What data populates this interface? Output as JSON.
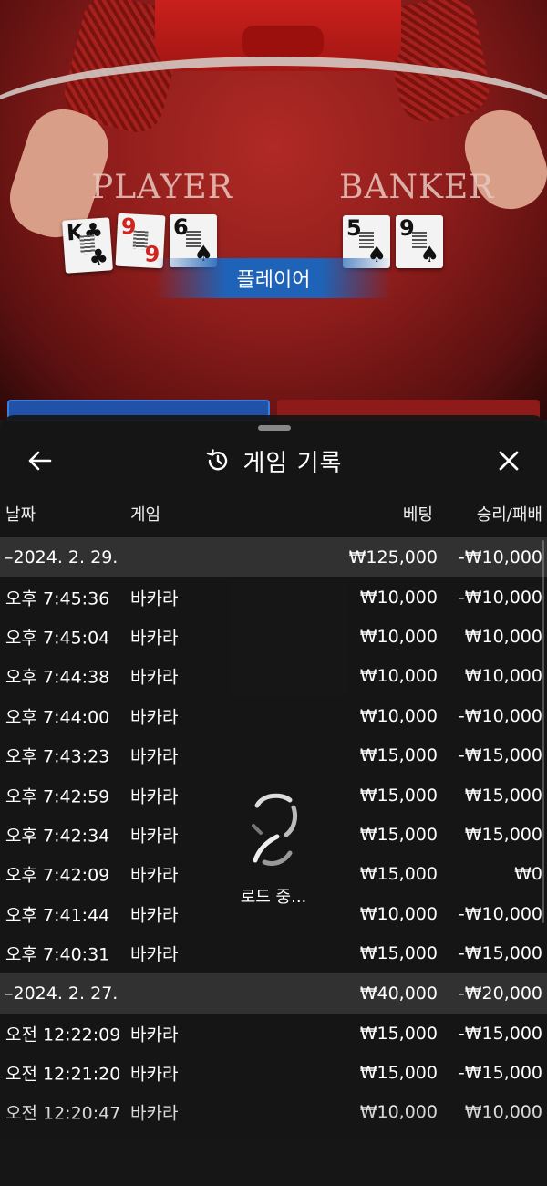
{
  "video": {
    "player_label": "PLAYER",
    "banker_label": "BANKER",
    "result_banner": "플레이어",
    "player_cards": [
      {
        "rank": "K",
        "suit": "♣",
        "color": "black"
      },
      {
        "rank": "9",
        "suit": "♦",
        "color": "red"
      },
      {
        "rank": "6",
        "suit": "♠",
        "color": "black"
      }
    ],
    "banker_cards": [
      {
        "rank": "5",
        "suit": "♠",
        "color": "black"
      },
      {
        "rank": "9",
        "suit": "♠",
        "color": "black"
      }
    ]
  },
  "sheet": {
    "title": "게임 기록",
    "back_icon": "arrow-left-icon",
    "history_icon": "history-icon",
    "close_icon": "close-icon",
    "columns": {
      "date": "날짜",
      "game": "게임",
      "bet": "베팅",
      "win_loss": "승리/패배"
    },
    "groups": [
      {
        "date": "–2024. 2. 29.",
        "bet_total": "₩125,000",
        "win_total": "-₩10,000",
        "rows": [
          {
            "time": "오후 7:45:36",
            "game": "바카라",
            "bet": "₩10,000",
            "win": "-₩10,000"
          },
          {
            "time": "오후 7:45:04",
            "game": "바카라",
            "bet": "₩10,000",
            "win": "₩10,000"
          },
          {
            "time": "오후 7:44:38",
            "game": "바카라",
            "bet": "₩10,000",
            "win": "₩10,000"
          },
          {
            "time": "오후 7:44:00",
            "game": "바카라",
            "bet": "₩10,000",
            "win": "-₩10,000"
          },
          {
            "time": "오후 7:43:23",
            "game": "바카라",
            "bet": "₩15,000",
            "win": "-₩15,000"
          },
          {
            "time": "오후 7:42:59",
            "game": "바카라",
            "bet": "₩15,000",
            "win": "₩15,000"
          },
          {
            "time": "오후 7:42:34",
            "game": "바카라",
            "bet": "₩15,000",
            "win": "₩15,000"
          },
          {
            "time": "오후 7:42:09",
            "game": "바카라",
            "bet": "₩15,000",
            "win": "₩0"
          },
          {
            "time": "오후 7:41:44",
            "game": "바카라",
            "bet": "₩10,000",
            "win": "-₩10,000"
          },
          {
            "time": "오후 7:40:31",
            "game": "바카라",
            "bet": "₩15,000",
            "win": "-₩15,000"
          }
        ]
      },
      {
        "date": "–2024. 2. 27.",
        "bet_total": "₩40,000",
        "win_total": "-₩20,000",
        "rows": [
          {
            "time": "오전 12:22:09",
            "game": "바카라",
            "bet": "₩15,000",
            "win": "-₩15,000"
          },
          {
            "time": "오전 12:21:20",
            "game": "바카라",
            "bet": "₩15,000",
            "win": "-₩15,000"
          },
          {
            "time": "오전 12:20:47",
            "game": "바카라",
            "bet": "₩10,000",
            "win": "₩10,000"
          }
        ]
      }
    ],
    "loading_text": "로드 중..."
  },
  "colors": {
    "player_blue": "#1e63b8",
    "banker_red": "#8f1a1a",
    "sheet_bg": "#161616"
  }
}
